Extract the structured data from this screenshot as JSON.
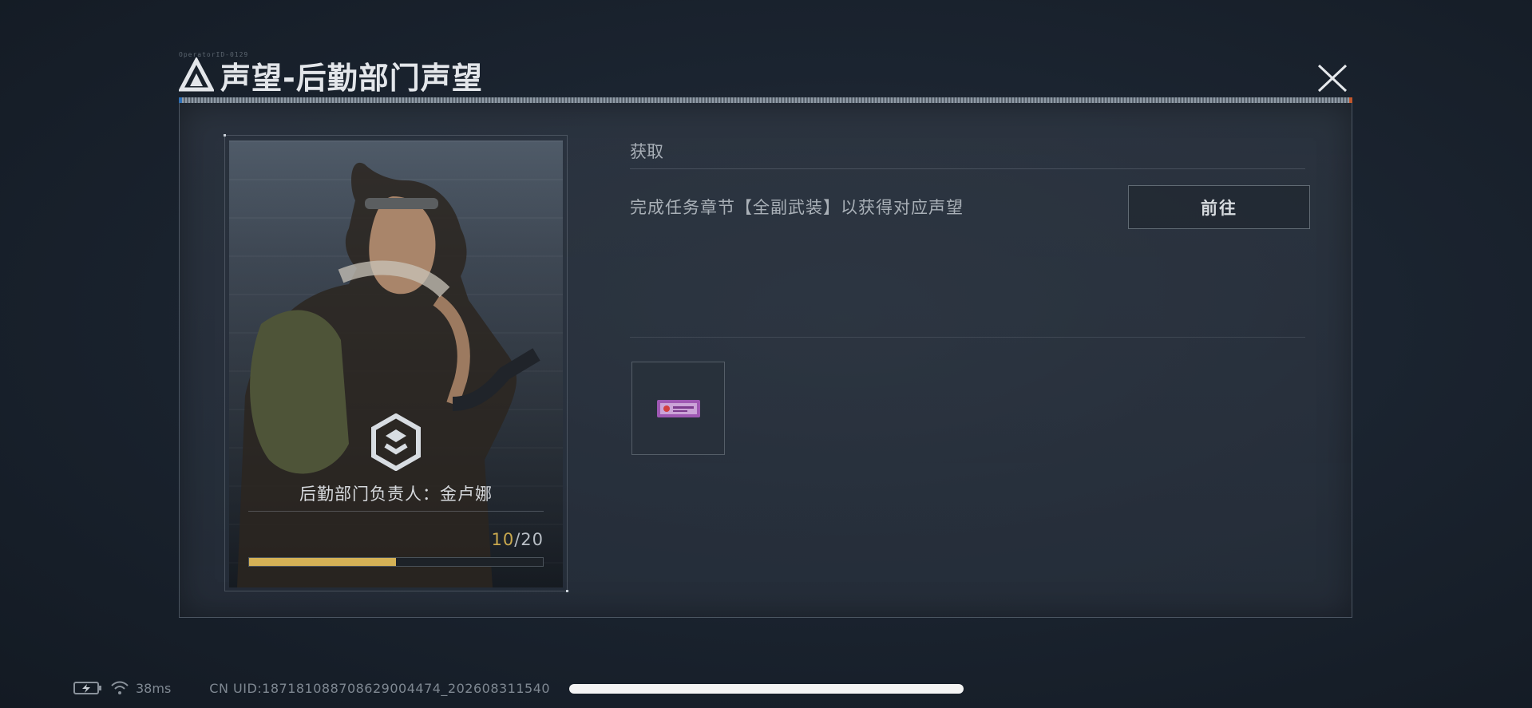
{
  "header": {
    "tiny_code": "OperatorID-0129",
    "title": "声望-后勤部门声望"
  },
  "card": {
    "leader_label": "后勤部门负责人：金卢娜",
    "progress": {
      "current": "10",
      "separator": "/",
      "max": "20",
      "fraction": 0.5
    }
  },
  "obtain": {
    "heading": "获取",
    "task_text": "完成任务章节【全副武装】以获得对应声望",
    "goto_label": "前往"
  },
  "status_bar": {
    "ping": "38ms",
    "uid": "CN UID:18718108870862900447​4_202608311540"
  },
  "icons": {
    "logo": "delta-logo-icon",
    "close": "close-icon",
    "emblem": "logistics-emblem-icon",
    "reward": "reward-badge-icon",
    "battery": "battery-charging-icon",
    "wifi": "wifi-icon"
  },
  "colors": {
    "progress_fill": "#d4b156",
    "progress_current": "#c8a84e",
    "accent_left": "#2f6fb5",
    "accent_right": "#c2572c"
  }
}
